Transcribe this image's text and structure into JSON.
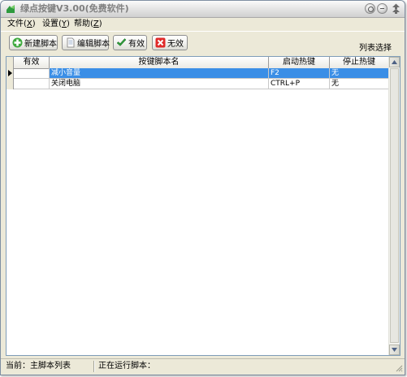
{
  "window": {
    "title": "绿点按键V3.00(免费软件)"
  },
  "menu": [
    {
      "label": "文件",
      "accel": "X"
    },
    {
      "label": "设置",
      "accel": "Y"
    },
    {
      "label": "帮助",
      "accel": "Z"
    }
  ],
  "toolbar": {
    "new_script": "新建脚本",
    "edit_script": "编辑脚本",
    "enable": "有效",
    "disable": "无效",
    "list_select": "列表选择"
  },
  "table": {
    "columns": [
      "有效",
      "按键脚本名",
      "启动热键",
      "停止热键"
    ],
    "rows": [
      {
        "enabled": "",
        "name": "减小音量",
        "start": "F2",
        "stop": "无",
        "selected": true
      },
      {
        "enabled": "",
        "name": "关闭电脑",
        "start": "CTRL+P",
        "stop": "无",
        "selected": false
      }
    ]
  },
  "status": {
    "current": "当前：主脚本列表",
    "running": "正在运行脚本："
  },
  "colors": {
    "selection": "#3a8ee6",
    "background": "#ece9d8"
  }
}
